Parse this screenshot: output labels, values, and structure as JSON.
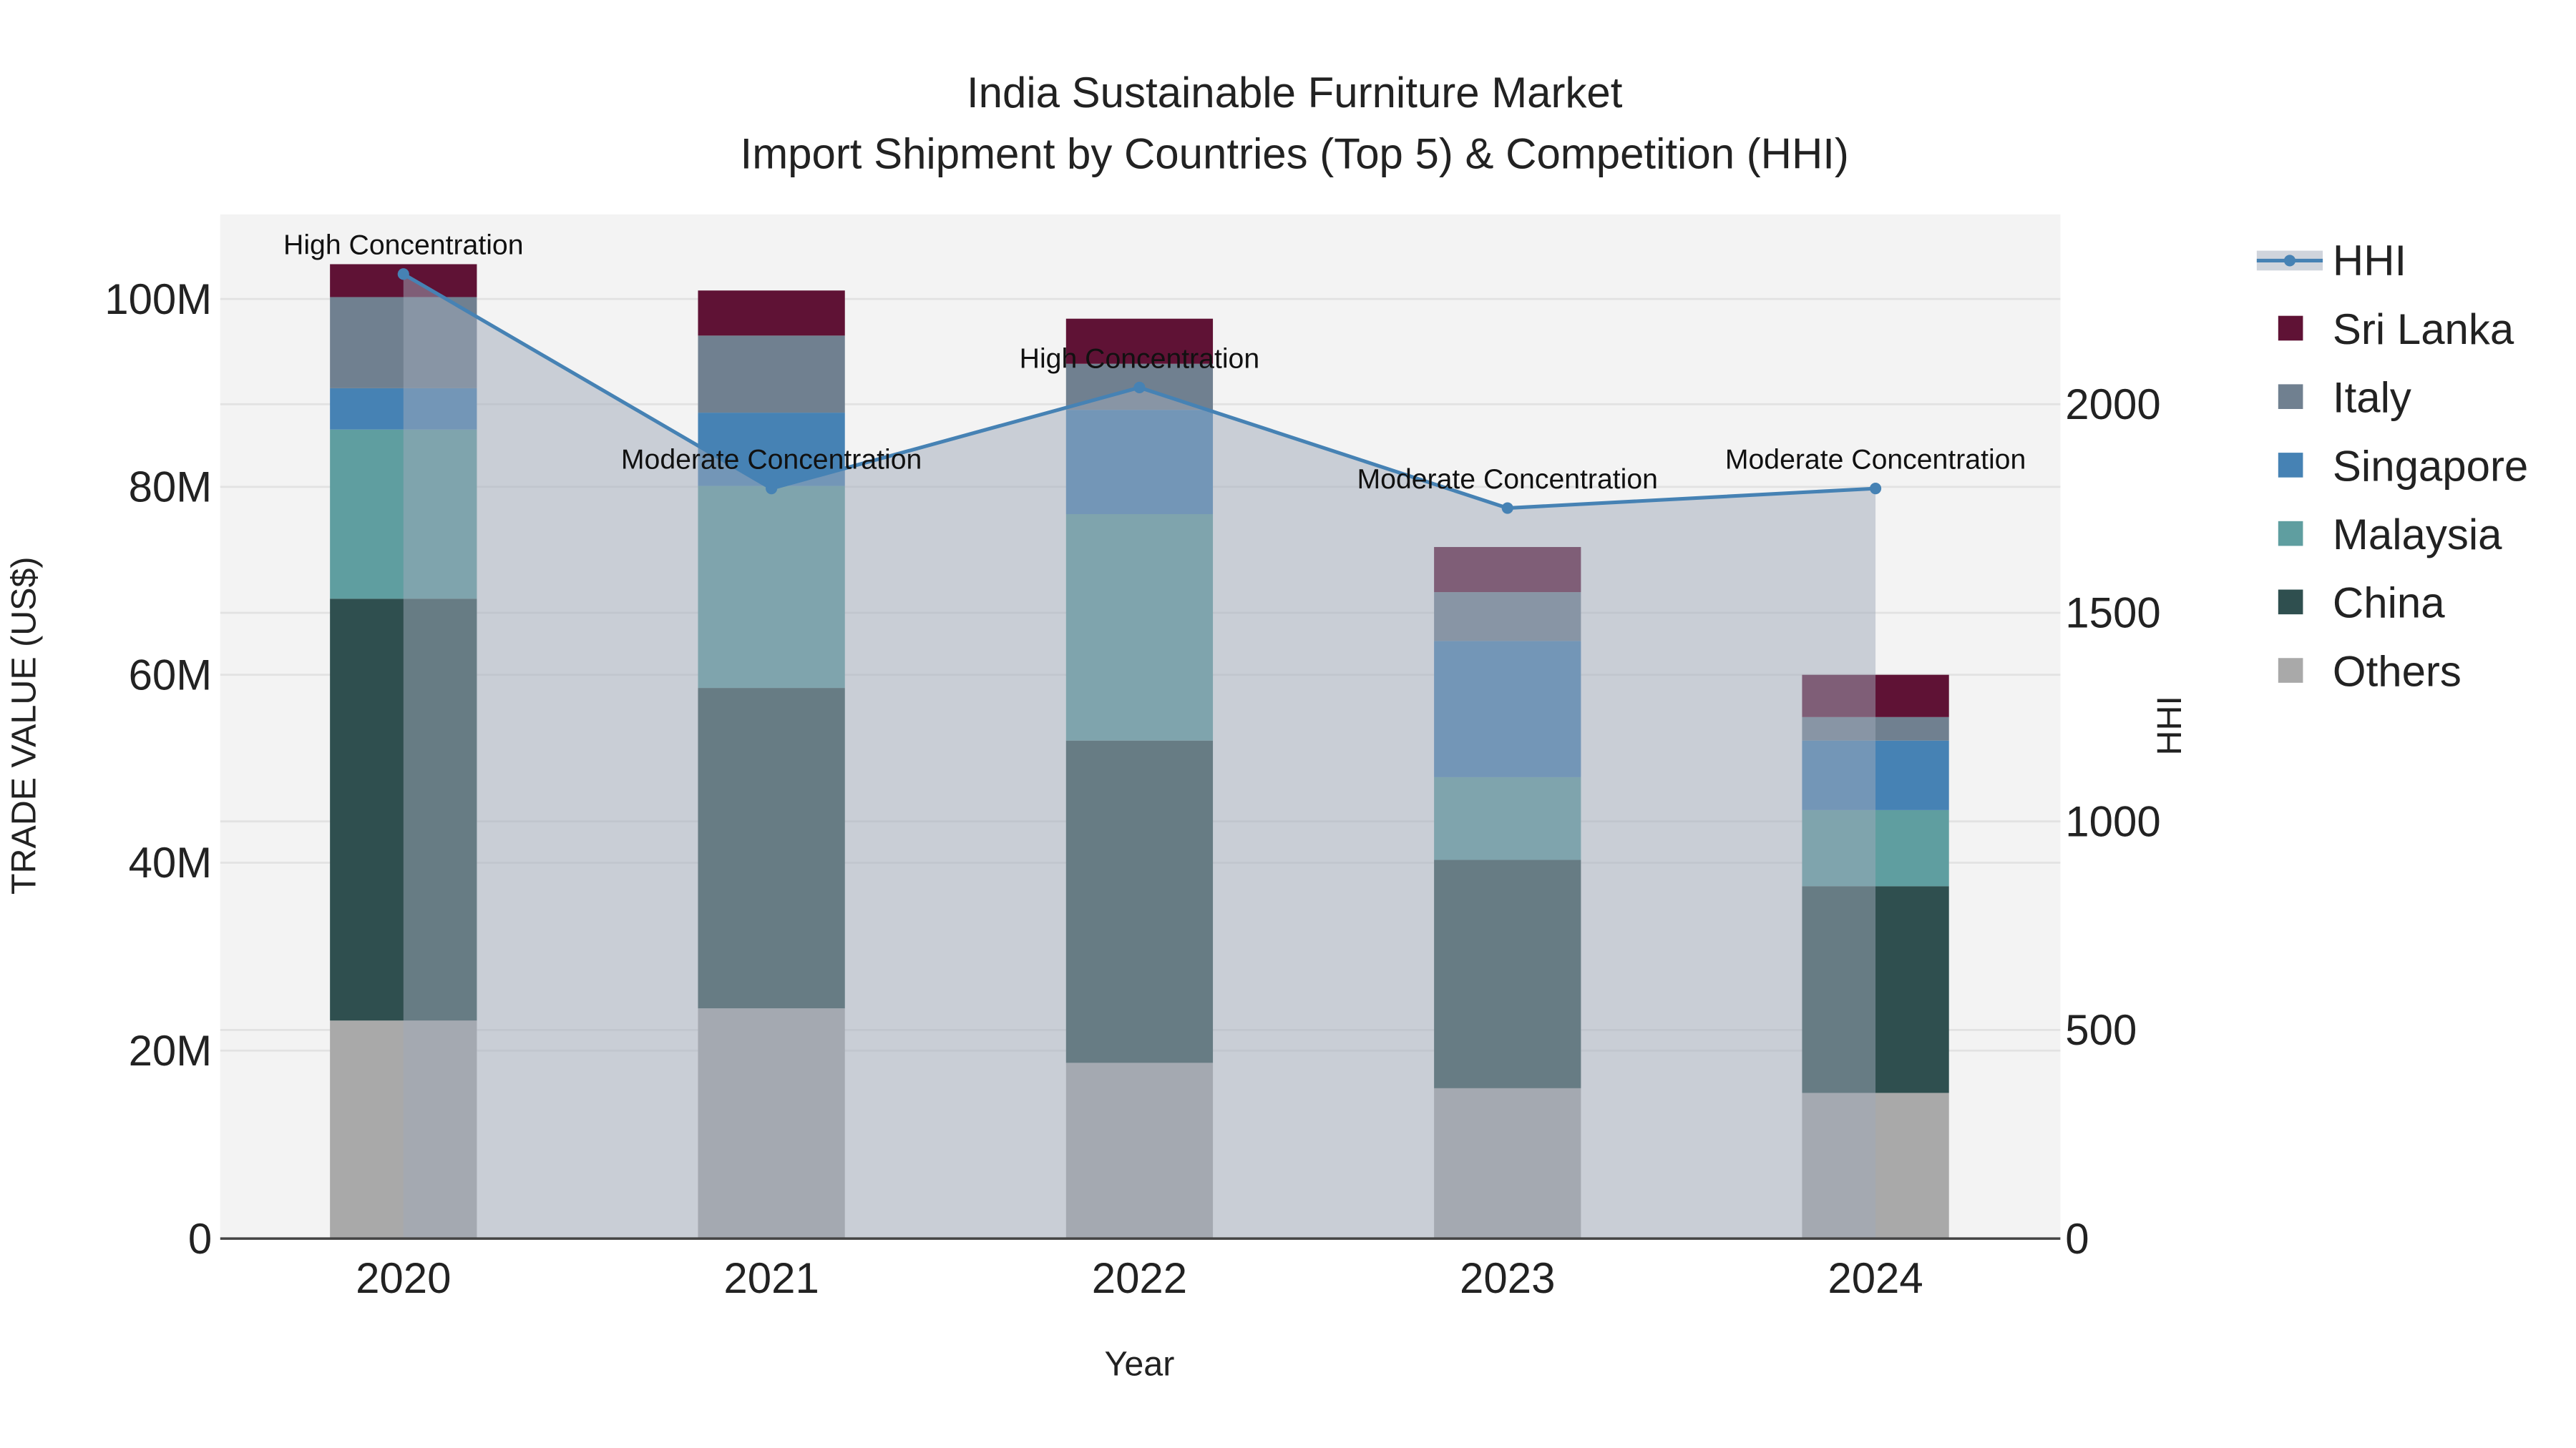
{
  "chart_data": {
    "type": "bar",
    "title": "India Sustainable Furniture Market",
    "subtitle": "Import Shipment by Countries (Top 5) & Competition (HHI)",
    "xlabel": "Year",
    "ylabel": "TRADE VALUE (US$)",
    "y2label": "HHI",
    "categories": [
      "2020",
      "2021",
      "2022",
      "2023",
      "2024"
    ],
    "ylim": [
      0,
      109
    ],
    "y_ticks": [
      0,
      20,
      40,
      60,
      80,
      100
    ],
    "y_tick_labels": [
      "0",
      "20M",
      "40M",
      "60M",
      "80M",
      "100M"
    ],
    "y2lim": [
      0,
      2455
    ],
    "y2_ticks": [
      0,
      500,
      1000,
      1500,
      2000
    ],
    "y2_tick_labels": [
      "0",
      "500",
      "1000",
      "1500",
      "2000"
    ],
    "grid": true,
    "legend_position": "right",
    "stacked": true,
    "units": "US$ millions",
    "series": [
      {
        "name": "Others",
        "color": "#a9a9a9",
        "values": [
          23.2,
          24.5,
          18.7,
          16.0,
          15.5
        ]
      },
      {
        "name": "China",
        "color": "#2f4f4f",
        "values": [
          44.9,
          34.1,
          34.3,
          24.3,
          22.0
        ]
      },
      {
        "name": "Malaysia",
        "color": "#5f9ea0",
        "values": [
          18.0,
          21.5,
          24.1,
          8.8,
          8.1
        ]
      },
      {
        "name": "Singapore",
        "color": "#4682b4",
        "values": [
          4.4,
          7.8,
          11.1,
          14.5,
          7.4
        ]
      },
      {
        "name": "Italy",
        "color": "#708090",
        "values": [
          9.7,
          8.2,
          4.9,
          5.2,
          2.5
        ]
      },
      {
        "name": "Sri Lanka",
        "color": "#5f1235",
        "values": [
          3.5,
          4.8,
          4.8,
          4.8,
          4.5
        ]
      }
    ],
    "hhi": {
      "name": "HHI",
      "color": "#4682b4",
      "values": [
        2312,
        1798,
        2040,
        1751,
        1798
      ],
      "annotations": [
        "High Concentration",
        "Moderate Concentration",
        "High Concentration",
        "Moderate Concentration",
        "Moderate Concentration"
      ]
    },
    "legend_order": [
      "HHI",
      "Sri Lanka",
      "Italy",
      "Singapore",
      "Malaysia",
      "China",
      "Others"
    ]
  }
}
